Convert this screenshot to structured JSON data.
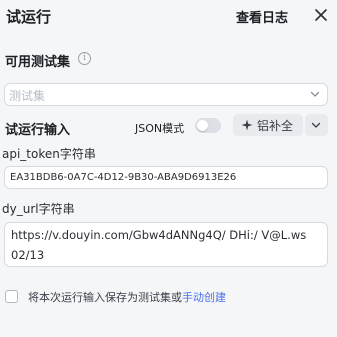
{
  "header": {
    "title": "试运行",
    "view_log": "查看日志",
    "close_icon": "close-icon"
  },
  "testset": {
    "label": "可用测试集",
    "info_icon": "info-icon",
    "select_placeholder": "测试集",
    "chevron_icon": "chevron-down-icon"
  },
  "run_input": {
    "label": "试运行输入",
    "json_mode_label": "JSON模式",
    "json_mode_on": false,
    "autofill_icon": "sparkle-icon",
    "autofill_label": "铝补全",
    "more_icon": "chevron-down-icon"
  },
  "fields": [
    {
      "name": "api_token字符串",
      "value": "EA31BDB6-0A7C-4D12-9B30-ABA9D6913E26"
    },
    {
      "name": "dy_url字符串",
      "value": "https://v.douyin.com/Gbw4dANNg4Q/ DHi:/ V@L.ws 02/13"
    }
  ],
  "save_option": {
    "checked": false,
    "prefix": "将本次运行输入保存为测试集或",
    "link": "手动创建"
  },
  "colors": {
    "background": "#f5f6f8",
    "link": "#4d6fe7",
    "border": "#d7dae0"
  }
}
